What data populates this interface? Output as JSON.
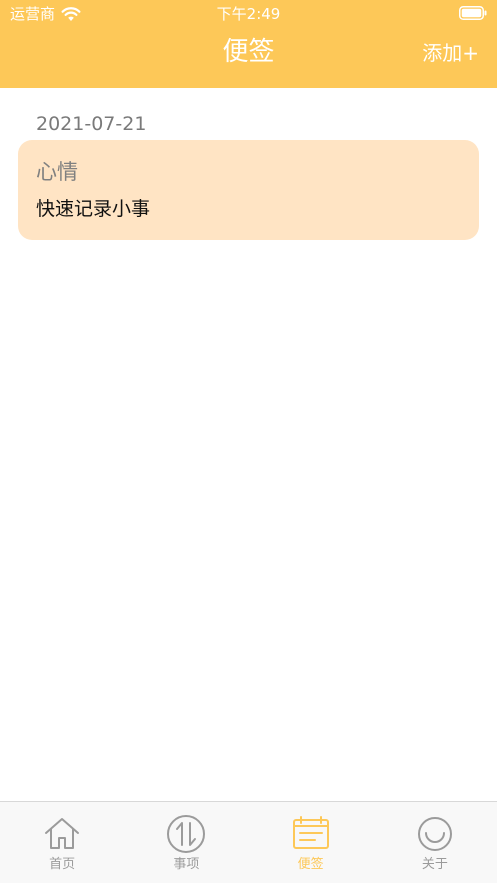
{
  "status_bar": {
    "carrier": "运营商",
    "time": "下午2:49"
  },
  "nav": {
    "title": "便签",
    "add_label": "添加+"
  },
  "notes": [
    {
      "date": "2021-07-21",
      "title": "心情",
      "body": "快速记录小事"
    }
  ],
  "tabs": [
    {
      "label": "首页",
      "icon": "home-icon",
      "active": false
    },
    {
      "label": "事项",
      "icon": "sort-arrows-icon",
      "active": false
    },
    {
      "label": "便签",
      "icon": "note-icon",
      "active": true
    },
    {
      "label": "关于",
      "icon": "smiley-icon",
      "active": false
    }
  ],
  "colors": {
    "accent": "#FDC858",
    "card_background": "#FFE4C4",
    "tab_inactive": "#9b9b9b"
  }
}
